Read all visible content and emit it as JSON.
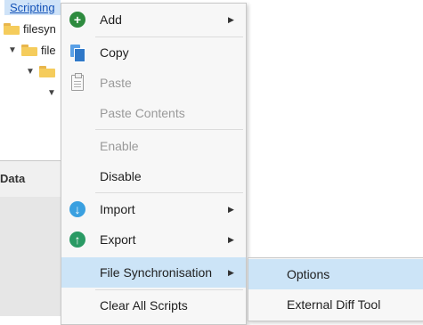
{
  "tree": {
    "root_label": "Scripting",
    "rows": [
      {
        "label": "filesyn"
      },
      {
        "label": "file"
      },
      {
        "label": ""
      }
    ],
    "data_header": "Data"
  },
  "context_menu": {
    "items": [
      {
        "label": "Add",
        "icon": "plus-circle-icon",
        "enabled": true,
        "submenu": true
      },
      {
        "label": "Copy",
        "icon": "copy-icon",
        "enabled": true,
        "submenu": false
      },
      {
        "label": "Paste",
        "icon": "clipboard-icon",
        "enabled": false,
        "submenu": false
      },
      {
        "label": "Paste Contents",
        "icon": "",
        "enabled": false,
        "submenu": false
      },
      {
        "label": "Enable",
        "icon": "",
        "enabled": false,
        "submenu": false
      },
      {
        "label": "Disable",
        "icon": "",
        "enabled": true,
        "submenu": false
      },
      {
        "label": "Import",
        "icon": "arrow-down-circle-icon",
        "enabled": true,
        "submenu": true
      },
      {
        "label": "Export",
        "icon": "arrow-up-circle-icon",
        "enabled": true,
        "submenu": true
      },
      {
        "label": "File Synchronisation",
        "icon": "",
        "enabled": true,
        "submenu": true,
        "highlighted": true
      },
      {
        "label": "Clear All Scripts",
        "icon": "",
        "enabled": true,
        "submenu": false
      }
    ]
  },
  "submenu": {
    "items": [
      {
        "label": "Options",
        "highlighted": true
      },
      {
        "label": "External Diff Tool",
        "highlighted": false
      }
    ]
  },
  "colors": {
    "highlight": "#cce4f7",
    "menu_bg": "#f7f7f7",
    "disabled_text": "#9a9a9a",
    "folder": "#f5cc5c"
  }
}
